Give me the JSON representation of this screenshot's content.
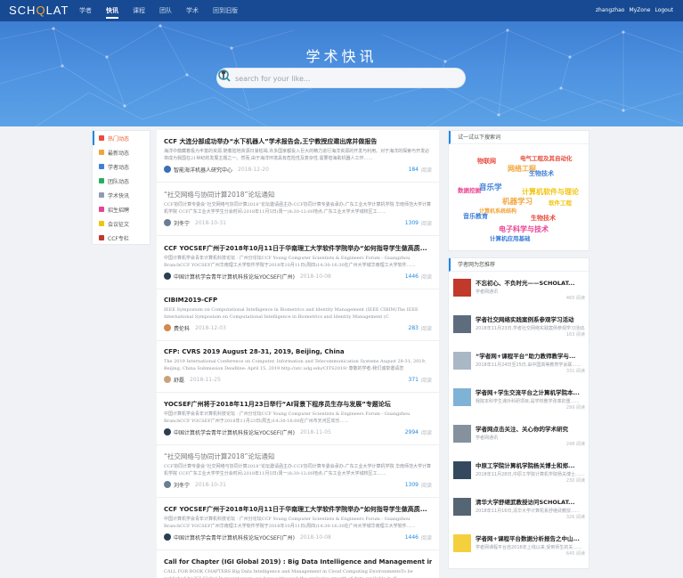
{
  "header": {
    "logo_prefix": "SCH",
    "logo_q": "Q",
    "logo_suffix": "LAT",
    "nav": [
      "学者",
      "快讯",
      "课程",
      "团队",
      "学术",
      "回到旧版"
    ],
    "active_nav": "快讯",
    "user": [
      "zhangzhao",
      "MyZone",
      "Logout"
    ]
  },
  "hero": {
    "title": "学术快讯",
    "search_placeholder": "search for your like..."
  },
  "sidebar": {
    "items": [
      {
        "label": "热门动态",
        "color": "#e84c3d"
      },
      {
        "label": "最新动态",
        "color": "#f2a53a"
      },
      {
        "label": "学者动态",
        "color": "#3f7fd8"
      },
      {
        "label": "团队动态",
        "color": "#27ae60"
      },
      {
        "label": "学术快讯",
        "color": "#8e9bb0"
      },
      {
        "label": "招生招聘",
        "color": "#e84393"
      },
      {
        "label": "会议征文",
        "color": "#f1c40f"
      },
      {
        "label": "CCF专栏",
        "color": "#c0392b"
      }
    ]
  },
  "feed": {
    "reads_label": "阅读",
    "articles": [
      {
        "title": "CCF 大连分部成功举办“水下机器人”学术报告会,王宁教授应邀出席并做报告",
        "abstract": "海洋中蕴藏着极为丰富的资源,随着陆地资源日渐枯竭,许多国家都投入巨大的精力进行海洋资源的开发与利用。对于海洋的探索与开发必将成为我国在21世纪的发展主题之一。然而,由于海洋环境具有危险性及复杂性,需要借海助机器人工作……",
        "author": "智能海洋机器人研究中心",
        "date": "2018-12-20",
        "reads": "184",
        "light": false,
        "avatar": "#3a6fb7"
      },
      {
        "title": "“社交网络与协同计算2018”论坛通知",
        "abstract": "CCF协同计算专委会“社交网络与协同计算2018”论坛邀请函主办:CCF协同计算专委会承办:广东工业大学计算机学院 华南师范大学计算机学院 CCF广东工业大学学生分会时间:2018年11月5日(周一)8:30-12:00地点:广东工业大学大学城校区工……",
        "author": "刘冬宁",
        "date": "2018-10-31",
        "reads": "1309",
        "light": true,
        "avatar": "#6b7d94"
      },
      {
        "title": "CCF YOCSEF广州于2018年10月11日于华南理工大学软件学院举办“如何指导学生做高质...",
        "abstract": "中国计算机学会青年计算机科技论坛 · 广州分论坛CCF Young Computer Scientists & Engineers Forum - Guangzhou BranchCCF YOCSEF广州华南理工大学软件学院于2018年10月11日(周四)14:30-16:30在广州大学城华南理工大学软件……",
        "author": "中国计算机学会青年计算机科技论坛YOCSEF(广州)",
        "date": "2018-10-08",
        "reads": "1446",
        "light": false,
        "avatar": "#2c3e50"
      },
      {
        "title": "CIBIM2019-CFP",
        "abstract": "IEEE Symposium on Computational Intelligence in Biometrics and Identity Management (IEEE CIBIM)The IEEE International Symposium on Computational Intelligence in Biometrics and Identity Management (C",
        "author": "费伦科",
        "date": "2018-12-03",
        "reads": "283",
        "light": false,
        "avatar": "#d4884a"
      },
      {
        "title": "CFP: CVRS 2019 August 28-31, 2019, Beijing, China",
        "abstract": "The 2019 International Conference on Computer, Information and Telecommunication Systems August 28-31, 2019, Beijing, China Submission Deadline: April 15, 2019 http://atc.udg.edu/CITS2019/ 尊敬的学者:我们诚挚邀请您",
        "author": "舒磊",
        "date": "2018-11-25",
        "reads": "371",
        "light": false,
        "avatar": "#c9a27a"
      },
      {
        "title": "YOCSEF广州将于2018年11月23日举行“AI背景下程序员生存与发展”专题论坛",
        "abstract": "中国计算机学会青年计算机科技论坛 · 广州分论坛CCF Young Computer Scientists & Engineers Forum - Guangzhou BranchCCF YOCSEF广州于2018年11月23日(周五)14:30-18:00在广州市天河区欢乐……",
        "author": "中国计算机学会青年计算机科技论坛YOCSEF(广州)",
        "date": "2018-11-05",
        "reads": "2994",
        "light": false,
        "avatar": "#2c3e50"
      },
      {
        "title": "“社交网络与协同计算2018”论坛通知",
        "abstract": "CCF协同计算专委会“社交网络与协同计算2018”论坛邀请函主办:CCF协同计算专委会承办:广东工业大学计算机学院 华南师范大学计算机学院 CCF广东工业大学学生分会时间:2018年11月5日(周一)8:30-12:00地点:广东工业大学大学城校区工……",
        "author": "刘冬宁",
        "date": "2018-10-31",
        "reads": "1309",
        "light": true,
        "avatar": "#6b7d94"
      },
      {
        "title": "CCF YOCSEF广州于2018年10月11日于华南理工大学软件学院举办“如何指导学生做高质...",
        "abstract": "中国计算机学会青年计算机科技论坛 · 广州分论坛CCF Young Computer Scientists & Engineers Forum - Guangzhou BranchCCF YOCSEF广州华南理工大学软件学院于2018年10月11日(周四)14:30-16:30在广州大学城华南理工大学软件……",
        "author": "中国计算机学会青年计算机科技论坛YOCSEF(广州)",
        "date": "2018-10-08",
        "reads": "1446",
        "light": false,
        "avatar": "#2c3e50"
      },
      {
        "title": "Call for Chapter (IGI Global 2019) : Big Data Intelligence and Management in Clo...",
        "abstract": "CALL FOR BOOK CHAPTERS Big Data Intelligence and Management in Cloud Computing EnvironmentsTo be published by IGI Global In recent years, we have witnessed the explosive growth of data available in di",
        "author": "",
        "date": "",
        "reads": "",
        "light": false,
        "avatar": ""
      }
    ]
  },
  "tag_cloud": {
    "title": "试一试以下搜索词",
    "tags": [
      {
        "text": "电气工程及其自动化",
        "color": "#e84c3d"
      },
      {
        "text": "物联网",
        "color": "#e84c3d"
      },
      {
        "text": "网络工程",
        "color": "#f2a53a"
      },
      {
        "text": "生物技术",
        "color": "#3f7fd8"
      },
      {
        "text": "音乐学",
        "color": "#3f7fd8"
      },
      {
        "text": "数据挖掘",
        "color": "#e84393"
      },
      {
        "text": "计算机软件与理论",
        "color": "#f1c40f"
      },
      {
        "text": "机器学习",
        "color": "#f2a53a"
      },
      {
        "text": "计算机系统结构",
        "color": "#f2a53a"
      },
      {
        "text": "软件工程",
        "color": "#f1c40f"
      },
      {
        "text": "音乐教育",
        "color": "#3f7fd8"
      },
      {
        "text": "生物技术",
        "color": "#e84c3d"
      },
      {
        "text": "电子科学与技术",
        "color": "#e84393"
      },
      {
        "text": "计算机应用基础",
        "color": "#3f7fd8"
      }
    ]
  },
  "recommend": {
    "title": "学者网为您推荐",
    "items": [
      {
        "title": "不忘初心、不负时光——SCHOLAT...",
        "sub": "学者网通讯",
        "reads": "465 阅读"
      },
      {
        "title": "学者社交网络实践案例系参观学习活动",
        "sub": "2018年11月23日,学者社交网络实践案例参观学习活动……",
        "reads": "163 阅读"
      },
      {
        "title": "“学者网+课程平台”助力教师教学与...",
        "sub": "2018年11月24日至25日,由中国高等教育学会联……",
        "reads": "331 阅读"
      },
      {
        "title": "学者网+学生交流平台之计算机学院本...",
        "sub": "我院本科学生课外科研项目,是学校教学改革的重……",
        "reads": "299 阅读"
      },
      {
        "title": "学者网点击关注、关心你的学术研究",
        "sub": "学者网通讯",
        "reads": "248 阅读"
      },
      {
        "title": "中原工学院计算机学院杨关博士和郑...",
        "sub": "2018年11月28日,中原工学院计算机学院杨关博士……",
        "reads": "230 阅读"
      },
      {
        "title": "清华大学舒继武教授访问SCHOLAT...",
        "sub": "2018年11月16日,清华大学计算机系舒继武教授……",
        "reads": "326 阅读"
      },
      {
        "title": "学者网+课程平台数据分析报告之中山...",
        "sub": "学者网课程平台自2016年上线以来,受到师生的关……",
        "reads": "645 阅读"
      }
    ]
  }
}
